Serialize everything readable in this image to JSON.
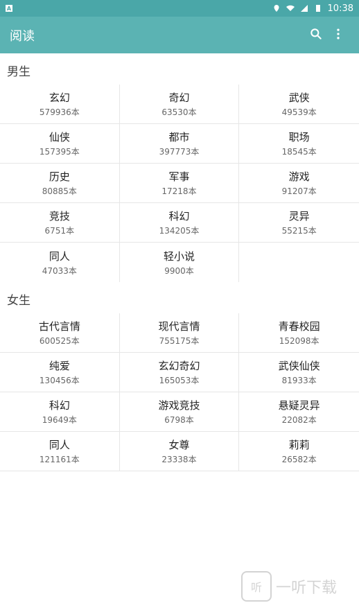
{
  "status_bar": {
    "time": "10:38",
    "left_badge": "A"
  },
  "app_bar": {
    "title": "阅读"
  },
  "sections": [
    {
      "title": "男生",
      "items": [
        {
          "name": "玄幻",
          "count": "579936本"
        },
        {
          "name": "奇幻",
          "count": "63530本"
        },
        {
          "name": "武侠",
          "count": "49539本"
        },
        {
          "name": "仙侠",
          "count": "157395本"
        },
        {
          "name": "都市",
          "count": "397773本"
        },
        {
          "name": "职场",
          "count": "18545本"
        },
        {
          "name": "历史",
          "count": "80885本"
        },
        {
          "name": "军事",
          "count": "17218本"
        },
        {
          "name": "游戏",
          "count": "91207本"
        },
        {
          "name": "竞技",
          "count": "6751本"
        },
        {
          "name": "科幻",
          "count": "134205本"
        },
        {
          "name": "灵异",
          "count": "55215本"
        },
        {
          "name": "同人",
          "count": "47033本"
        },
        {
          "name": "轻小说",
          "count": "9900本"
        }
      ]
    },
    {
      "title": "女生",
      "items": [
        {
          "name": "古代言情",
          "count": "600525本"
        },
        {
          "name": "现代言情",
          "count": "755175本"
        },
        {
          "name": "青春校园",
          "count": "152098本"
        },
        {
          "name": "纯爱",
          "count": "130456本"
        },
        {
          "name": "玄幻奇幻",
          "count": "165053本"
        },
        {
          "name": "武侠仙侠",
          "count": "81933本"
        },
        {
          "name": "科幻",
          "count": "19649本"
        },
        {
          "name": "游戏竞技",
          "count": "6798本"
        },
        {
          "name": "悬疑灵异",
          "count": "22082本"
        },
        {
          "name": "同人",
          "count": "121161本"
        },
        {
          "name": "女尊",
          "count": "23338本"
        },
        {
          "name": "莉莉",
          "count": "26582本"
        }
      ]
    }
  ],
  "watermark": {
    "box": "听",
    "text": "一听下载"
  },
  "colors": {
    "status": "#4aa7a8",
    "appbar": "#5bb3b3"
  }
}
